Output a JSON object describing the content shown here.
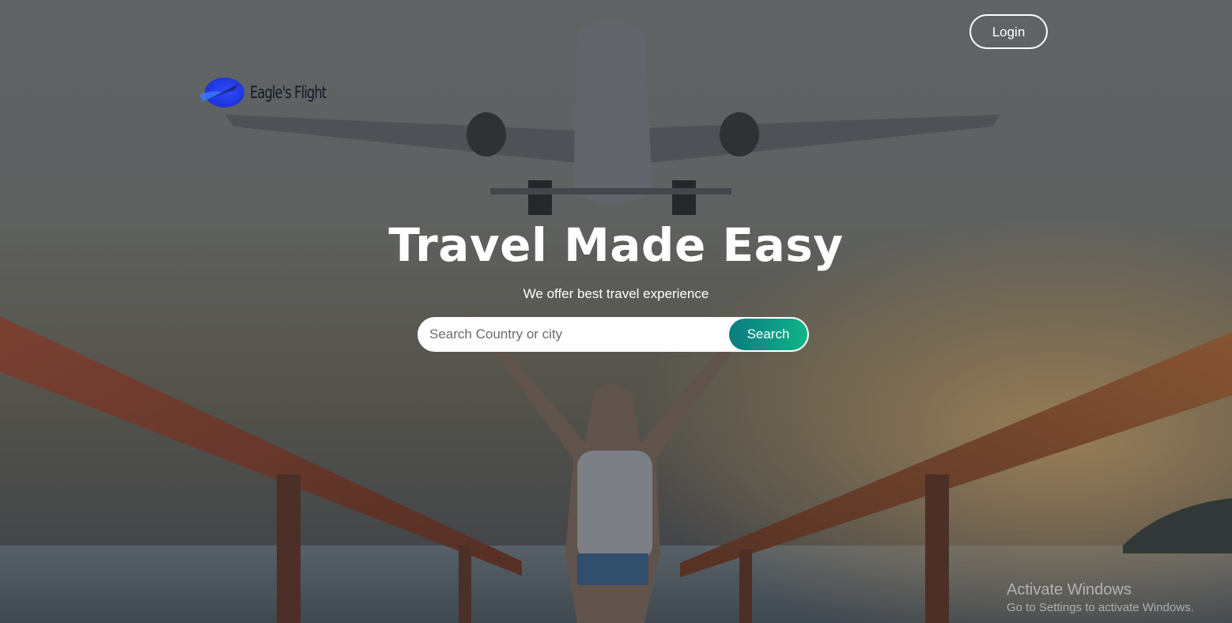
{
  "brand": {
    "name": "Eagle's Flight",
    "logo_icon": "plane-swoosh-logo",
    "logo_color": "#1f3ef0"
  },
  "header": {
    "login_label": "Login"
  },
  "hero": {
    "title": "Travel Made Easy",
    "subtitle": "We offer best travel experience",
    "background": "airplane-over-pier-photo"
  },
  "search": {
    "placeholder": "Search Country or city",
    "value": "",
    "button_label": "Search",
    "button_color": "#0c9a86"
  },
  "watermark": {
    "title": "Activate Windows",
    "subtitle": "Go to Settings to activate Windows."
  }
}
